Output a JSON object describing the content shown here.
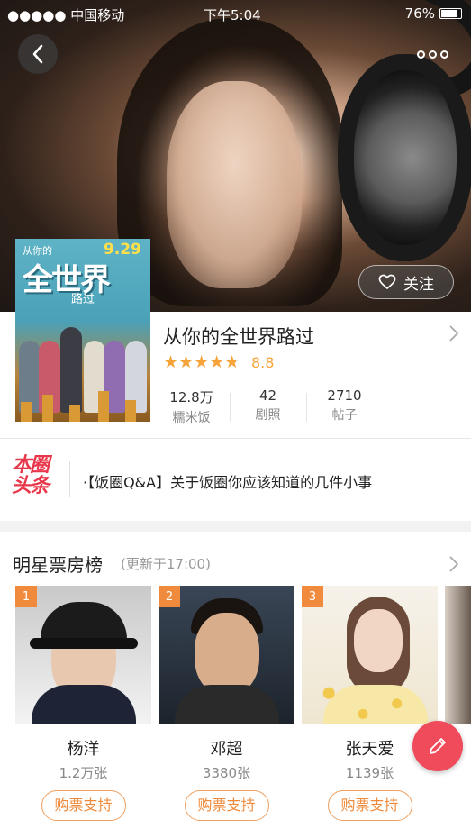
{
  "status_bar": {
    "carrier": "●●●●● 中国移动",
    "time": "下午5:04",
    "battery": "76%"
  },
  "header": {
    "follow_label": "关注"
  },
  "poster": {
    "title": "全世界",
    "subtitle": "路过",
    "top_text": "从你的",
    "date": "9.29"
  },
  "movie": {
    "title": "从你的全世界路过",
    "rating": 8.8,
    "rating_text": "8.8",
    "stats": [
      {
        "value": "12.8万",
        "label": "糯米饭"
      },
      {
        "value": "42",
        "label": "剧照"
      },
      {
        "value": "2710",
        "label": "帖子"
      }
    ]
  },
  "headline": {
    "logo_line1": "本圈",
    "logo_line2": "头条",
    "text": "·【饭圈Q&A】关于饭圈你应该知道的几件小事"
  },
  "box_office": {
    "title": "明星票房榜",
    "subtitle": "(更新于17:00)",
    "stars": [
      {
        "rank": "1",
        "name": "杨洋",
        "count": "1.2万张",
        "buy_label": "购票支持"
      },
      {
        "rank": "2",
        "name": "邓超",
        "count": "3380张",
        "buy_label": "购票支持"
      },
      {
        "rank": "3",
        "name": "张天爱",
        "count": "1139张",
        "buy_label": "购票支持"
      }
    ]
  }
}
